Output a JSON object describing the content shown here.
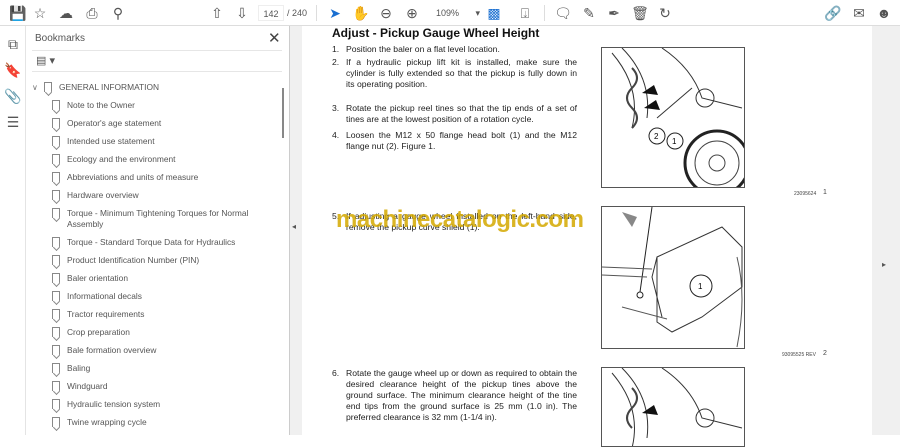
{
  "toolbar": {
    "page_current": "142",
    "page_total": "/ 240",
    "zoom": "109%"
  },
  "bookmarks": {
    "title": "Bookmarks",
    "root": "GENERAL INFORMATION",
    "items": [
      "Note to the Owner",
      "Operator's age statement",
      "Intended use statement",
      "Ecology and the environment",
      "Abbreviations and units of measure",
      "Hardware overview",
      "Torque - Minimum Tightening Torques for Normal Assembly",
      "Torque - Standard Torque Data for Hydraulics",
      "Product Identification Number (PIN)",
      "Baler orientation",
      "Informational decals",
      "Tractor requirements",
      "Crop preparation",
      "Bale formation overview",
      "Baling",
      "Windguard",
      "Hydraulic tension system",
      "Twine wrapping cycle"
    ]
  },
  "document": {
    "heading": "Adjust - Pickup Gauge Wheel Height",
    "steps": [
      {
        "n": "1.",
        "text": "Position the baler on a flat level location."
      },
      {
        "n": "2.",
        "text": "If a hydraulic pickup lift kit is installed, make sure the cylinder is fully extended so that the pickup is fully down in its operating position."
      },
      {
        "n": "3.",
        "text": "Rotate the pickup reel tines so that the tip ends of a set of tines are at the lowest position of a rotation cycle."
      },
      {
        "n": "4.",
        "text": "Loosen the M12 x 50 flange head bolt (1) and the M12 flange nut (2). Figure 1."
      },
      {
        "n": "5.",
        "text": "If adjusting a gauge wheel installed on the left-hand side, remove the pickup curve shield (1)."
      },
      {
        "n": "6.",
        "text": "Rotate the gauge wheel up or down as required to obtain the desired clearance height of the pickup tines above the ground surface.  The minimum clearance height of the tine end tips from the ground surface is 25 mm (1.0 in).  The preferred clearance is 32 mm (1-1/4 in)."
      }
    ],
    "figures": [
      {
        "code": "23095624",
        "num": "1",
        "callouts": [
          "2",
          "1"
        ]
      },
      {
        "code": "93095525 REV",
        "num": "2",
        "callouts": [
          "1"
        ]
      }
    ],
    "watermark": "machinecatalogic.com"
  }
}
